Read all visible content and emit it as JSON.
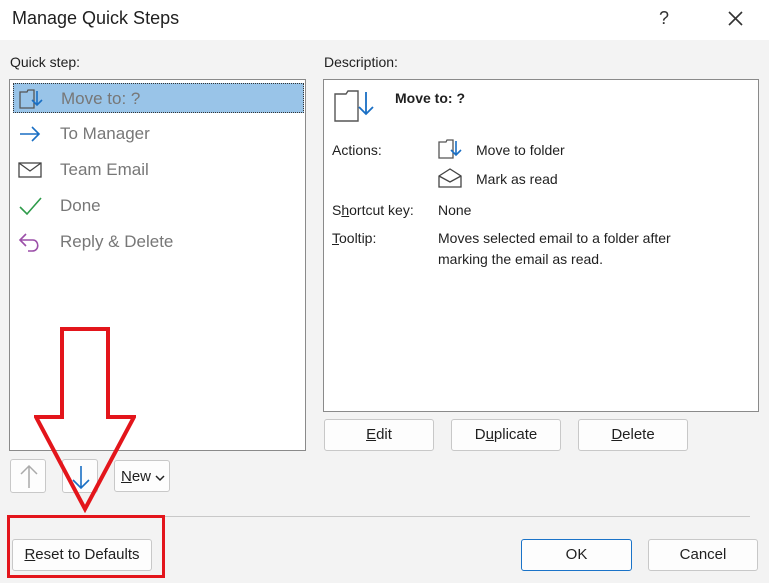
{
  "window": {
    "title": "Manage Quick Steps",
    "help": "?"
  },
  "list": {
    "label": "Quick step:",
    "items": [
      {
        "label": "Move to: ?",
        "icon": "move-to-folder-icon",
        "selected": true
      },
      {
        "label": "To Manager",
        "icon": "arrow-right-icon"
      },
      {
        "label": "Team Email",
        "icon": "envelope-icon"
      },
      {
        "label": "Done",
        "icon": "checkmark-icon"
      },
      {
        "label": "Reply & Delete",
        "icon": "reply-icon"
      }
    ]
  },
  "description": {
    "label": "Description:",
    "name": "Move to: ?",
    "actions_label": "Actions:",
    "actions": [
      {
        "label": "Move to folder",
        "icon": "move-to-folder-icon"
      },
      {
        "label": "Mark as read",
        "icon": "open-envelope-icon"
      }
    ],
    "shortcut_label_pre": "S",
    "shortcut_label_ul": "h",
    "shortcut_label_post": "ortcut key:",
    "shortcut_value": "None",
    "tooltip_label_ul": "T",
    "tooltip_label_post": "ooltip:",
    "tooltip_line1": "Moves selected email to a folder after",
    "tooltip_line2": "marking the email as read."
  },
  "buttons": {
    "edit_ul": "E",
    "edit_post": "dit",
    "duplicate_pre": "D",
    "duplicate_ul": "u",
    "duplicate_post": "plicate",
    "delete_ul": "D",
    "delete_post": "elete",
    "new_ul": "N",
    "new_post": "ew",
    "reset_ul": "R",
    "reset_post": "eset to Defaults",
    "ok": "OK",
    "cancel": "Cancel"
  },
  "colors": {
    "accent": "#1a73c8",
    "annotation": "#e3151b",
    "selection": "#99c4e8"
  }
}
